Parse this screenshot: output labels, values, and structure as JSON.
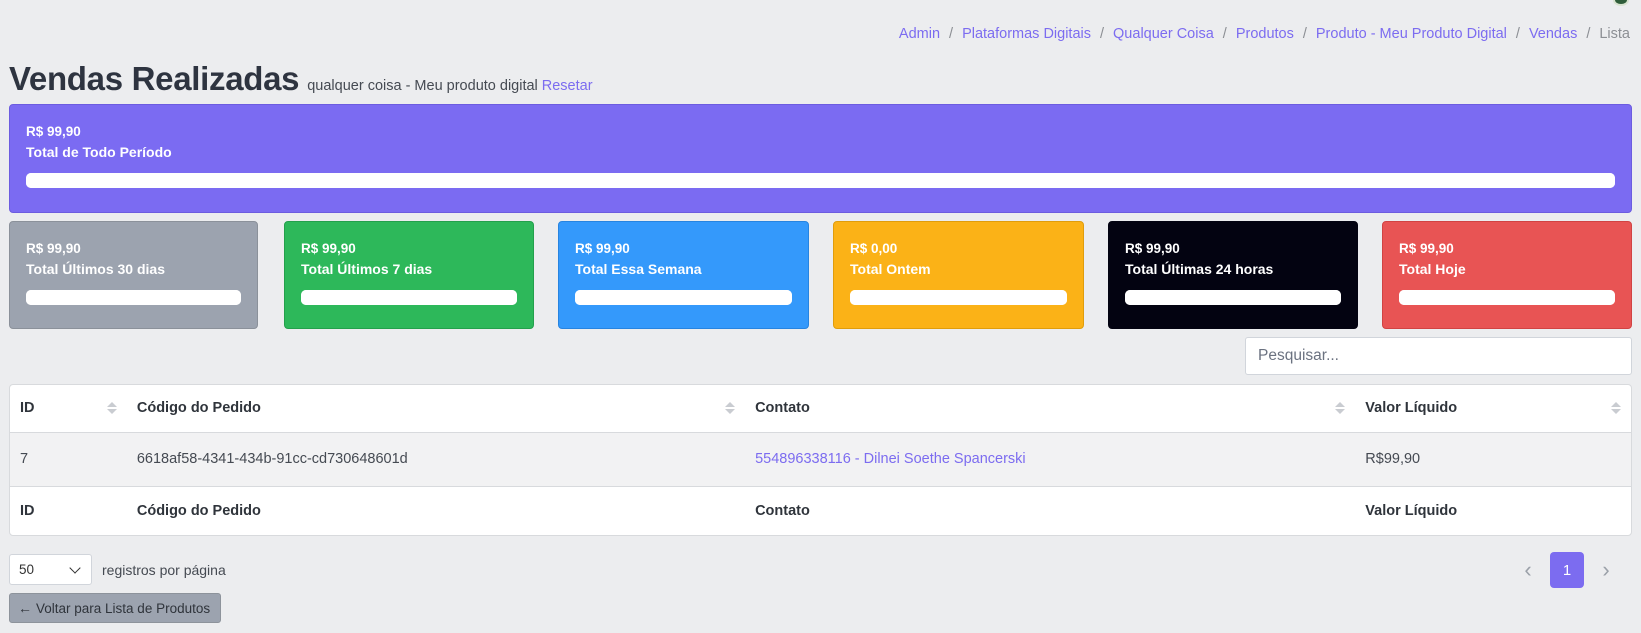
{
  "breadcrumb": [
    {
      "label": "Admin",
      "active": false
    },
    {
      "label": "Plataformas Digitais",
      "active": false
    },
    {
      "label": "Qualquer Coisa",
      "active": false
    },
    {
      "label": "Produtos",
      "active": false
    },
    {
      "label": "Produto - Meu Produto Digital",
      "active": false
    },
    {
      "label": "Vendas",
      "active": false
    },
    {
      "label": "Lista",
      "active": true
    }
  ],
  "breadcrumb_separator": "/",
  "header": {
    "title": "Vendas Realizadas",
    "subtitle": "qualquer coisa - Meu produto digital",
    "reset_label": "Resetar"
  },
  "cards": [
    {
      "key": "total",
      "amount": "R$ 99,90",
      "label": "Total de Todo Período",
      "color": "#7b6bf2",
      "border": "#6c5ce0",
      "progress": 100
    },
    {
      "key": "30d",
      "amount": "R$ 99,90",
      "label": "Total Últimos 30 dias",
      "color": "#9ca3af",
      "border": "#8b919a",
      "progress": 100
    },
    {
      "key": "7d",
      "amount": "R$ 99,90",
      "label": "Total Últimos 7 dias",
      "color": "#2db85a",
      "border": "#23a04c",
      "progress": 100
    },
    {
      "key": "week",
      "amount": "R$ 99,90",
      "label": "Total Essa Semana",
      "color": "#3499fb",
      "border": "#2784e0",
      "progress": 100
    },
    {
      "key": "yesterday",
      "amount": "R$ 0,00",
      "label": "Total Ontem",
      "color": "#fbb217",
      "border": "#e09d0c",
      "progress": 100
    },
    {
      "key": "24h",
      "amount": "R$ 99,90",
      "label": "Total Últimas 24 horas",
      "color": "#030311",
      "border": "#030311",
      "progress": 100
    },
    {
      "key": "today",
      "amount": "R$ 99,90",
      "label": "Total Hoje",
      "color": "#e85454",
      "border": "#d14343",
      "progress": 100
    }
  ],
  "search": {
    "placeholder": "Pesquisar..."
  },
  "table": {
    "columns": [
      "ID",
      "Código do Pedido",
      "Contato",
      "Valor Líquido"
    ],
    "rows": [
      {
        "id": "7",
        "order_code": "6618af58-4341-434b-91cc-cd730648601d",
        "contact": "554896338116 - Dilnei Soethe Spancerski",
        "net_value": "R$99,90"
      }
    ]
  },
  "pagination": {
    "per_page_value": "50",
    "per_page_label": "registros por página",
    "prev_icon": "chevron-left-icon",
    "next_icon": "chevron-right-icon",
    "pages": [
      "1"
    ],
    "current_page": "1"
  },
  "back_button": {
    "label": "Voltar para Lista de Produtos",
    "icon": "arrow-left-icon"
  }
}
